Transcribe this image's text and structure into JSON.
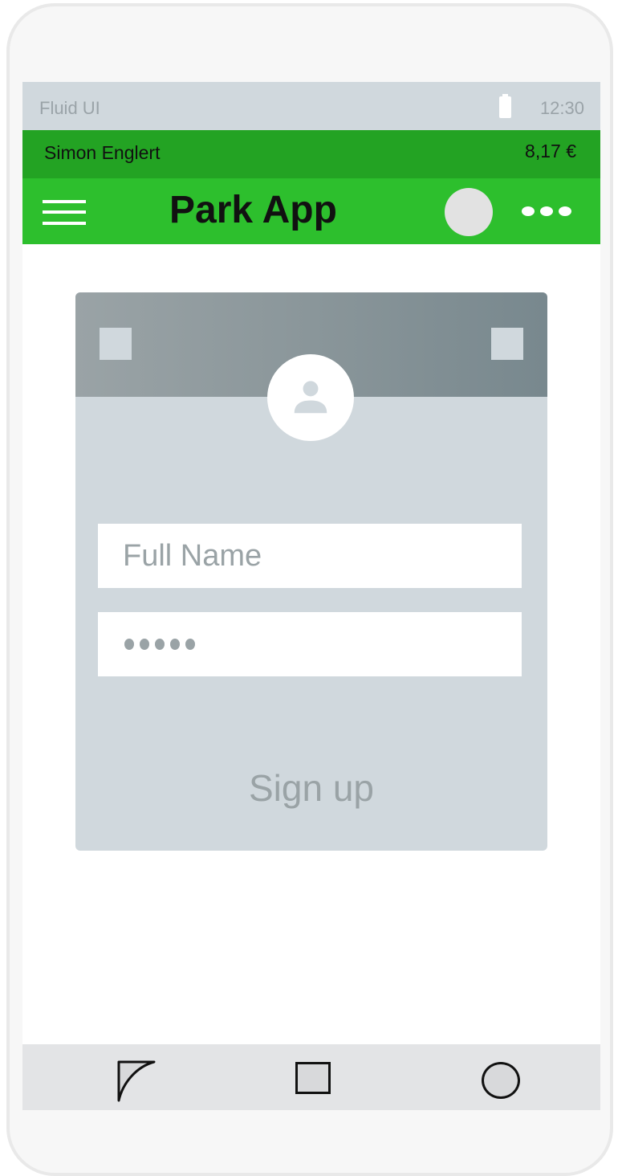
{
  "status_bar": {
    "app_name": "Fluid UI",
    "time": "12:30",
    "battery_icon": "battery-icon"
  },
  "account_bar": {
    "user_name": "Simon Englert",
    "balance": "8,17 €"
  },
  "app_bar": {
    "title": "Park App",
    "menu_icon": "hamburger-menu-icon",
    "avatar_icon": "avatar-icon",
    "more_icon": "more-options-icon"
  },
  "signup_card": {
    "profile_icon": "person-icon",
    "name_placeholder": "Full Name",
    "password_mask": "•••••",
    "submit_label": "Sign up"
  },
  "nav_bar": {
    "back_icon": "back-triangle-icon",
    "home_icon": "home-square-icon",
    "recent_icon": "recent-circle-icon"
  },
  "colors": {
    "status_bar_bg": "#d0d8dd",
    "account_bar_bg": "#23a323",
    "app_bar_bg": "#2dbf2d",
    "card_bg": "#d0d8dd",
    "muted_text": "#9aa3a6",
    "nav_bar_bg": "#e3e4e6"
  }
}
